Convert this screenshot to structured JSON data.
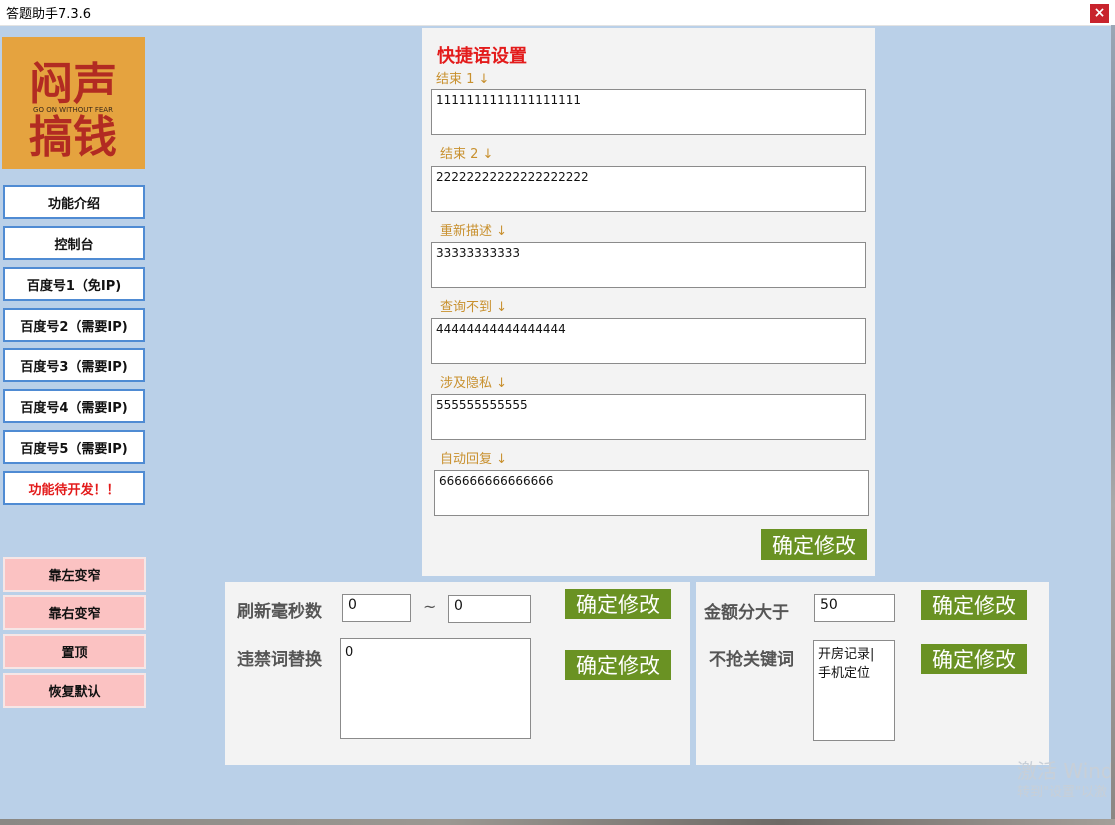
{
  "window": {
    "title": "答题助手7.3.6",
    "close_glyph": "×"
  },
  "logo": {
    "line1": "闷声",
    "line2": "搞钱",
    "tagline": "GO ON WITHOUT FEAR",
    "bg_color": "#e5a33f",
    "text_color": "#b22b22"
  },
  "sidebar": {
    "nav": [
      {
        "label": "功能介绍"
      },
      {
        "label": "控制台"
      },
      {
        "label": "百度号1（免IP)"
      },
      {
        "label": "百度号2（需要IP)"
      },
      {
        "label": "百度号3（需要IP)"
      },
      {
        "label": "百度号4（需要IP)"
      },
      {
        "label": "百度号5（需要IP)"
      },
      {
        "label": "功能待开发！！"
      }
    ],
    "actions": [
      {
        "label": "靠左变窄"
      },
      {
        "label": "靠右变窄"
      },
      {
        "label": "置顶"
      },
      {
        "label": "恢复默认"
      }
    ]
  },
  "quick_phrases": {
    "title": "快捷语设置",
    "fields": [
      {
        "label": "结束 1 ↓",
        "value": "1111111111111111111"
      },
      {
        "label": "结束 2 ↓",
        "value": "22222222222222222222"
      },
      {
        "label": "重新描述 ↓",
        "value": "33333333333"
      },
      {
        "label": "查询不到 ↓",
        "value": "44444444444444444"
      },
      {
        "label": "涉及隐私 ↓",
        "value": "555555555555"
      },
      {
        "label": "自动回复 ↓",
        "value": "666666666666666"
      }
    ],
    "confirm_label": "确定修改"
  },
  "refresh_panel": {
    "refresh_label": "刷新毫秒数",
    "min_value": "0",
    "separator": "~",
    "max_value": "0",
    "confirm_label_1": "确定修改",
    "replace_label": "违禁词替换",
    "replace_value": "0",
    "confirm_label_2": "确定修改"
  },
  "amount_panel": {
    "amount_label": "金额分大于",
    "amount_value": "50",
    "confirm_label_1": "确定修改",
    "keywords_label": "不抢关键词",
    "keywords_line1": "开房记录|",
    "keywords_line2": "手机定位",
    "confirm_label_2": "确定修改"
  },
  "watermark": {
    "line1": "激活 Wind",
    "line2": "转到\"设置\"以激"
  },
  "colors": {
    "background": "#bad0e8",
    "panel": "#f3f3f3",
    "accent_green": "#6a9223",
    "nav_border": "#4f8bd3",
    "action_pink": "#fbc2c2",
    "title_red": "#e31b1b",
    "label_gold": "#c8902e"
  }
}
